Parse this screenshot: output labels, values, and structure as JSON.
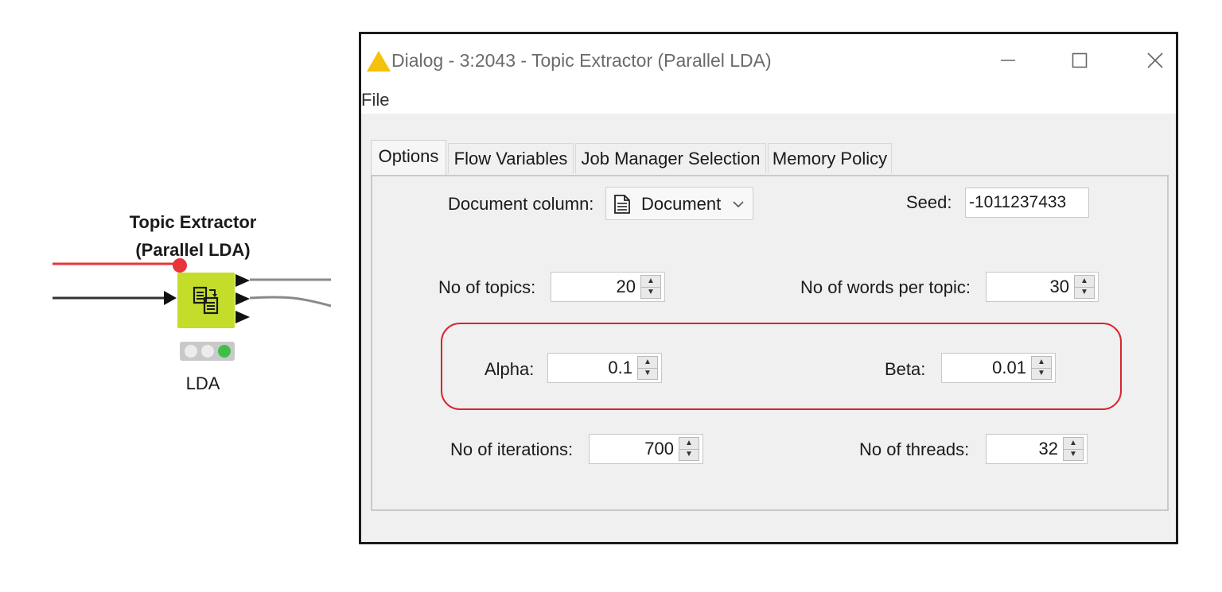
{
  "node": {
    "title_line1": "Topic Extractor",
    "title_line2": "(Parallel LDA)",
    "label": "LDA",
    "icon": "topic-extractor-icon",
    "color": "#c4dd2a",
    "status": "executed"
  },
  "dialog": {
    "title": "Dialog - 3:2043 - Topic Extractor (Parallel LDA)",
    "title_icon": "warning-icon",
    "menu": {
      "file": "File"
    },
    "tabs": [
      {
        "label": "Options",
        "active": true
      },
      {
        "label": "Flow Variables",
        "active": false
      },
      {
        "label": "Job Manager Selection",
        "active": false
      },
      {
        "label": "Memory Policy",
        "active": false
      }
    ],
    "options": {
      "document_column": {
        "label": "Document column:",
        "value": "Document",
        "icon": "document-icon"
      },
      "seed": {
        "label": "Seed:",
        "value": "-1011237433"
      },
      "no_of_topics": {
        "label": "No of topics:",
        "value": "20"
      },
      "no_of_words_per_topic": {
        "label": "No of words per topic:",
        "value": "30"
      },
      "alpha": {
        "label": "Alpha:",
        "value": "0.1"
      },
      "beta": {
        "label": "Beta:",
        "value": "0.01"
      },
      "no_of_iterations": {
        "label": "No of iterations:",
        "value": "700"
      },
      "no_of_threads": {
        "label": "No of threads:",
        "value": "32"
      }
    },
    "highlight_color": "#d9252b"
  }
}
